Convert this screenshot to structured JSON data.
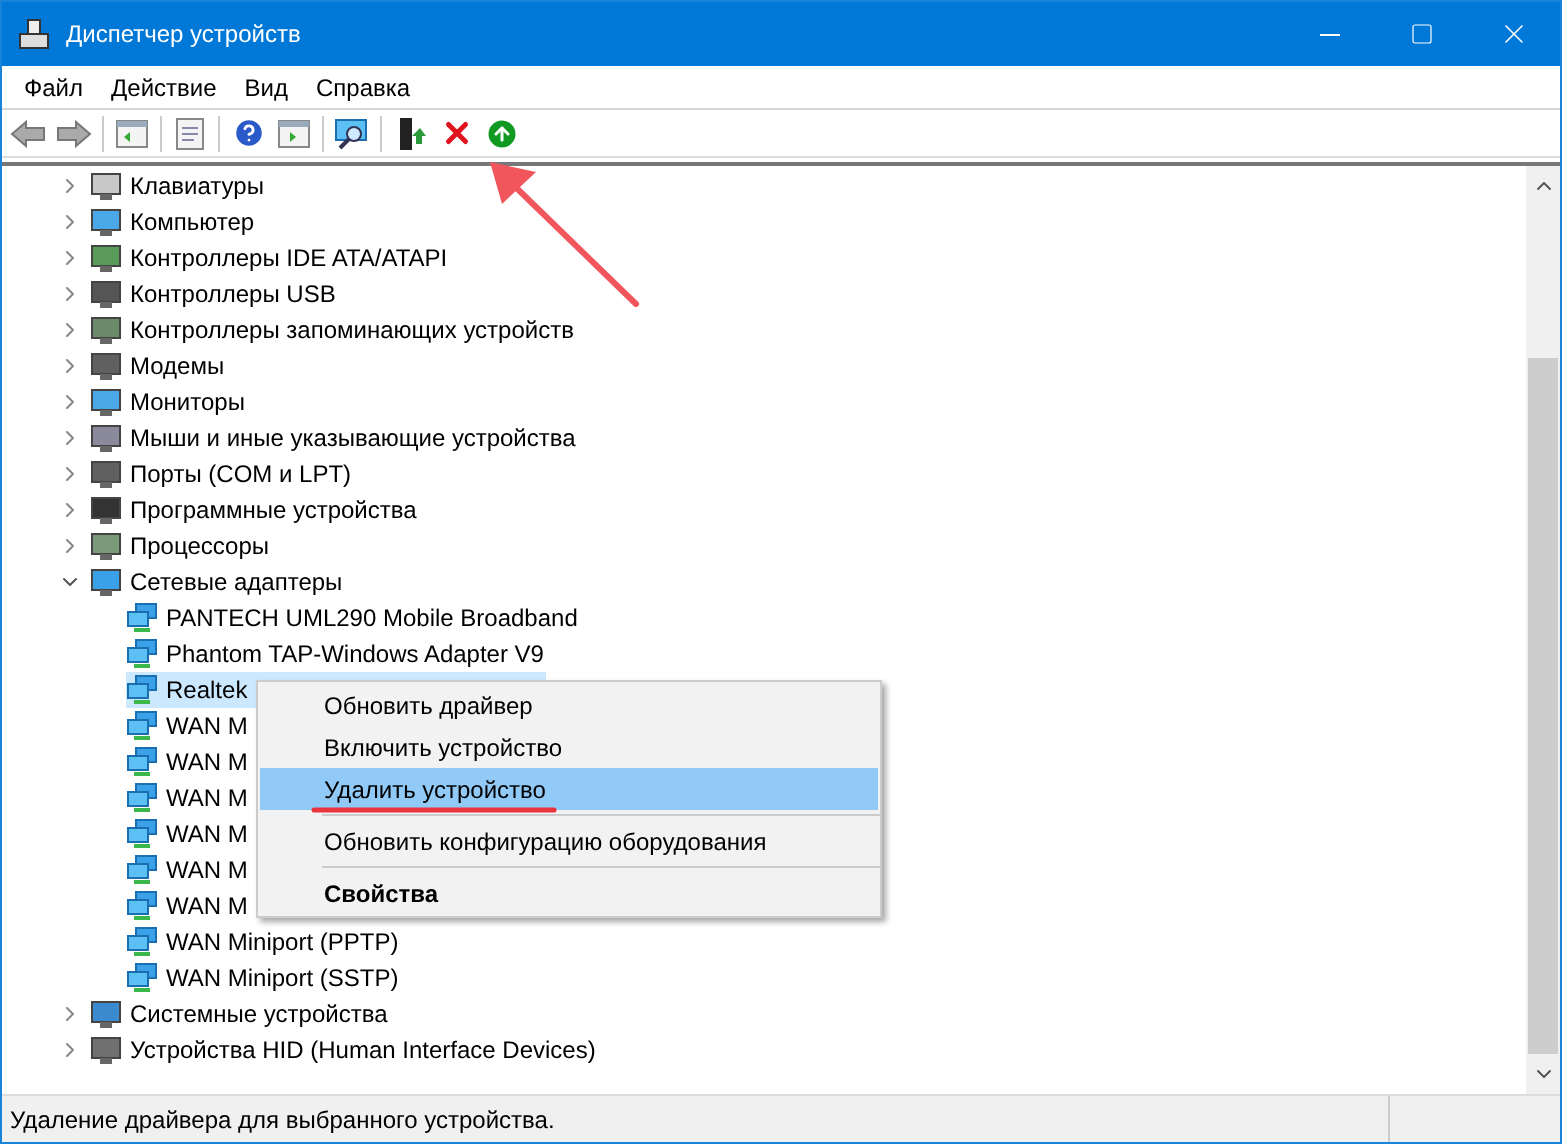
{
  "window": {
    "title": "Диспетчер устройств"
  },
  "menu_bar": [
    "Файл",
    "Действие",
    "Вид",
    "Справка"
  ],
  "tree": [
    {
      "label": "Клавиатуры",
      "expanded": false
    },
    {
      "label": "Компьютер",
      "expanded": false
    },
    {
      "label": "Контроллеры IDE ATA/ATAPI",
      "expanded": false
    },
    {
      "label": "Контроллеры USB",
      "expanded": false
    },
    {
      "label": "Контроллеры запоминающих устройств",
      "expanded": false
    },
    {
      "label": "Модемы",
      "expanded": false
    },
    {
      "label": "Мониторы",
      "expanded": false
    },
    {
      "label": "Мыши и иные указывающие устройства",
      "expanded": false
    },
    {
      "label": "Порты (COM и LPT)",
      "expanded": false
    },
    {
      "label": "Программные устройства",
      "expanded": false
    },
    {
      "label": "Процессоры",
      "expanded": false
    },
    {
      "label": "Сетевые адаптеры",
      "expanded": true,
      "children": [
        {
          "label": "PANTECH UML290 Mobile Broadband",
          "selected": false
        },
        {
          "label": "Phantom TAP-Windows Adapter V9",
          "selected": false
        },
        {
          "label": "Realtek",
          "selected": true
        },
        {
          "label": "WAN M",
          "selected": false
        },
        {
          "label": "WAN M",
          "selected": false
        },
        {
          "label": "WAN M",
          "selected": false
        },
        {
          "label": "WAN M",
          "selected": false
        },
        {
          "label": "WAN M",
          "selected": false
        },
        {
          "label": "WAN M",
          "selected": false
        },
        {
          "label": "WAN Miniport (PPTP)",
          "selected": false
        },
        {
          "label": "WAN Miniport (SSTP)",
          "selected": false
        }
      ]
    },
    {
      "label": "Системные устройства",
      "expanded": false
    },
    {
      "label": "Устройства HID (Human Interface Devices)",
      "expanded": false
    }
  ],
  "context_menu": [
    {
      "kind": "item",
      "label": "Обновить драйвер",
      "selected": false
    },
    {
      "kind": "item",
      "label": "Включить устройство",
      "selected": false
    },
    {
      "kind": "item",
      "label": "Удалить устройство",
      "selected": true
    },
    {
      "kind": "separator"
    },
    {
      "kind": "item",
      "label": "Обновить конфигурацию оборудования",
      "selected": false
    },
    {
      "kind": "separator"
    },
    {
      "kind": "default",
      "label": "Свойства",
      "selected": false
    }
  ],
  "status_bar": "Удаление драйвера для выбранного устройства."
}
